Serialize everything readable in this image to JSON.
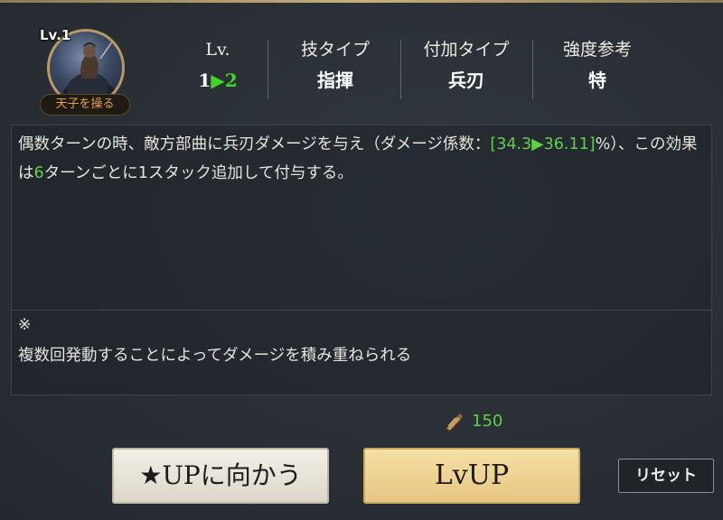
{
  "skill": {
    "level_badge": "Lv.1",
    "name": "天子を操る"
  },
  "stats": [
    {
      "label": "Lv.",
      "value_from": "1",
      "arrow": "▶",
      "value_to": "2"
    },
    {
      "label": "技タイプ",
      "value": "指揮"
    },
    {
      "label": "付加タイプ",
      "value": "兵刃"
    },
    {
      "label": "強度参考",
      "value": "特"
    }
  ],
  "description": {
    "part1": "偶数ターンの時、敵方部曲に兵刃ダメージを与え（ダメージ係数：",
    "coef": "[34.3▶36.11]",
    "part2": "%）、この効果は",
    "turns": "6",
    "part3": "ターンごとに1スタック追加して付与する。"
  },
  "note": {
    "mark": "※",
    "text": "複数回発動することによってダメージを積み重ねられる"
  },
  "cost": {
    "icon": "scroll-item-icon",
    "value": "150"
  },
  "buttons": {
    "star_up": "★UPに向かう",
    "lv_up": "LvUP",
    "reset": "リセット"
  },
  "colors": {
    "accent_green": "#3fd52a",
    "gold_border": "#b89a62",
    "background": "#2a2f36"
  }
}
